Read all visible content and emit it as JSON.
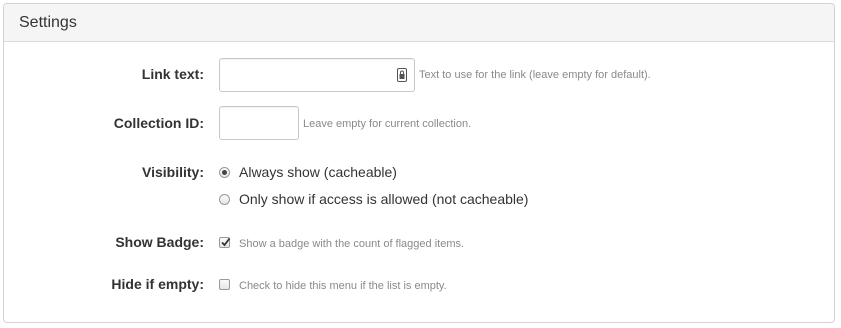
{
  "panel": {
    "title": "Settings"
  },
  "fields": {
    "link_text": {
      "label": "Link text:",
      "value": "",
      "placeholder": "",
      "help": "Text to use for the link (leave empty for default)."
    },
    "collection_id": {
      "label": "Collection ID:",
      "value": "",
      "placeholder": "",
      "help": "Leave empty for current collection."
    },
    "visibility": {
      "label": "Visibility:",
      "options": [
        {
          "label": "Always show (cacheable)",
          "checked": true
        },
        {
          "label": "Only show if access is allowed (not cacheable)",
          "checked": false
        }
      ]
    },
    "show_badge": {
      "label": "Show Badge:",
      "checked": true,
      "help": "Show a badge with the count of flagged items."
    },
    "hide_if_empty": {
      "label": "Hide if empty:",
      "checked": false,
      "help": "Check to hide this menu if the list is empty."
    }
  },
  "icons": {
    "link_text_field_icon": "password-manager-icon"
  }
}
